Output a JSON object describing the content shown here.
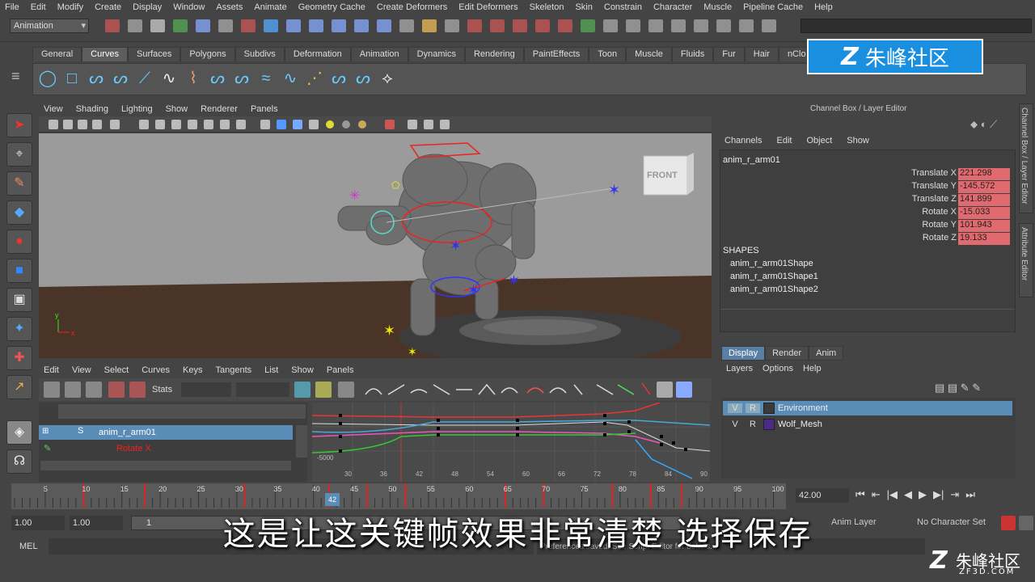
{
  "menubar": [
    "File",
    "Edit",
    "Modify",
    "Create",
    "Display",
    "Window",
    "Assets",
    "Animate",
    "Geometry Cache",
    "Create Deformers",
    "Edit Deformers",
    "Skeleton",
    "Skin",
    "Constrain",
    "Character",
    "Muscle",
    "Pipeline Cache",
    "Help"
  ],
  "mode_selector": "Animation",
  "shelf_tabs": [
    "General",
    "Curves",
    "Surfaces",
    "Polygons",
    "Subdivs",
    "Deformation",
    "Animation",
    "Dynamics",
    "Rendering",
    "PaintEffects",
    "Toon",
    "Muscle",
    "Fluids",
    "Fur",
    "Hair",
    "nClo"
  ],
  "active_shelf_tab": "Curves",
  "viewport_menu": [
    "View",
    "Shading",
    "Lighting",
    "Show",
    "Renderer",
    "Panels"
  ],
  "viewcube_label": "FRONT",
  "graph_menu": [
    "Edit",
    "View",
    "Select",
    "Curves",
    "Keys",
    "Tangents",
    "List",
    "Show",
    "Panels"
  ],
  "graph_stats_label": "Stats",
  "graph_outliner": {
    "item": "anim_r_arm01",
    "sub_item": "Rotate X"
  },
  "graph_area": {
    "y_tick": "-5000",
    "x_ticks": [
      "30",
      "36",
      "42",
      "48",
      "54",
      "60",
      "66",
      "72",
      "78",
      "84",
      "90"
    ]
  },
  "channel_box": {
    "title": "Channel Box / Layer Editor",
    "menu": [
      "Channels",
      "Edit",
      "Object",
      "Show"
    ],
    "object": "anim_r_arm01",
    "attributes": [
      {
        "label": "Translate X",
        "value": "221.298"
      },
      {
        "label": "Translate Y",
        "value": "-145.572"
      },
      {
        "label": "Translate Z",
        "value": "141.899"
      },
      {
        "label": "Rotate X",
        "value": "-15.033"
      },
      {
        "label": "Rotate Y",
        "value": "101.943"
      },
      {
        "label": "Rotate Z",
        "value": "19.133"
      }
    ],
    "shapes_header": "SHAPES",
    "shapes": [
      "anim_r_arm01Shape",
      "anim_r_arm01Shape1",
      "anim_r_arm01Shape2"
    ],
    "side_tabs": [
      "Channel Box / Layer Editor",
      "Attribute Editor"
    ]
  },
  "layer_editor": {
    "tabs": [
      "Display",
      "Render",
      "Anim"
    ],
    "active_tab": "Display",
    "menu": [
      "Layers",
      "Options",
      "Help"
    ],
    "layers": [
      {
        "v": "V",
        "r": "R",
        "name": "Environment",
        "selected": true,
        "color": "#3a3a3a"
      },
      {
        "v": "V",
        "r": "R",
        "name": "Wolf_Mesh",
        "selected": false,
        "color": "#4a2a8a"
      }
    ]
  },
  "timeline": {
    "ticks": [
      "5",
      "10",
      "15",
      "20",
      "25",
      "30",
      "35",
      "40",
      "45",
      "50",
      "55",
      "60",
      "65",
      "70",
      "75",
      "80",
      "85",
      "90",
      "95",
      "100"
    ],
    "current_frame_marker": "42",
    "current_frame_field": "42.00"
  },
  "range": {
    "start": "1.00",
    "start2": "1.00",
    "field": "1",
    "anim_layer": "Anim Layer",
    "character_set": "No Character Set"
  },
  "command_line": {
    "label": "MEL",
    "feedback": "Preferences saved. See Script Editor for details."
  },
  "subtitle": "这是让这关键帧效果非常清楚  选择保存",
  "watermark_top": "朱峰社区",
  "watermark_br": {
    "name": "朱峰社区",
    "url": "ZF3D.COM"
  }
}
